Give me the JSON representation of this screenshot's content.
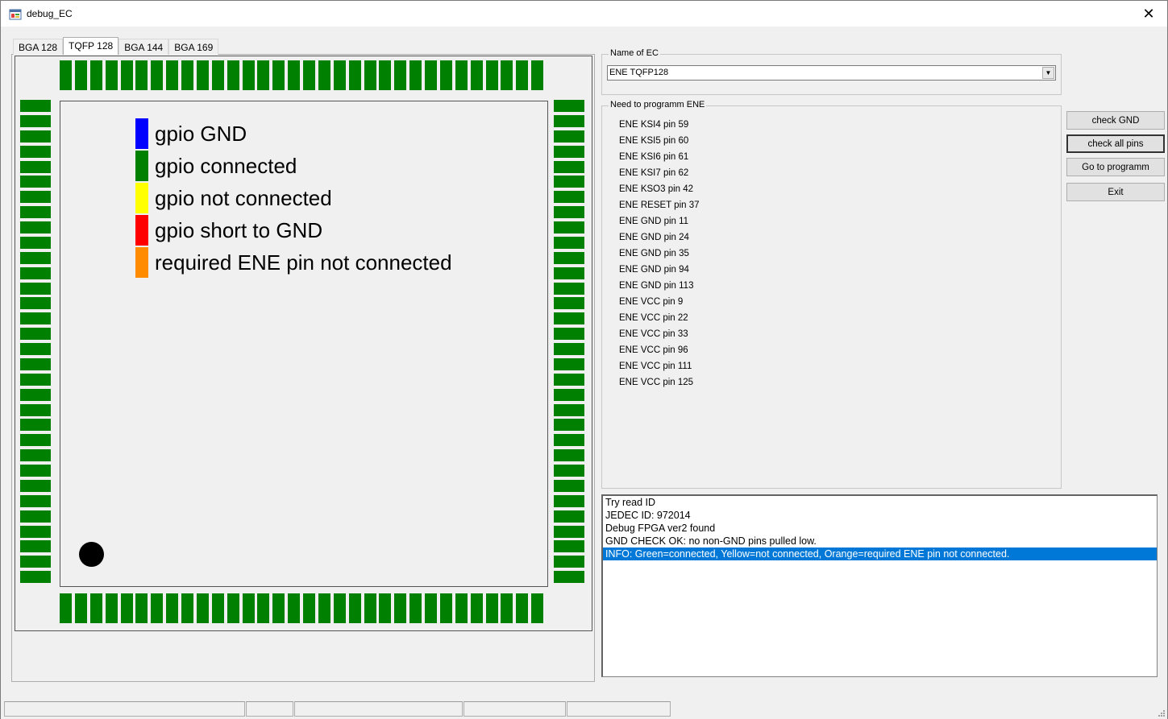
{
  "window": {
    "title": "debug_EC",
    "close_glyph": "✕"
  },
  "tabs": [
    {
      "label": "BGA 128",
      "active": false
    },
    {
      "label": "TQFP 128",
      "active": true
    },
    {
      "label": "BGA 144",
      "active": false
    },
    {
      "label": "BGA 169",
      "active": false
    }
  ],
  "legend": [
    {
      "label": "gpio GND",
      "color": "#0000ff"
    },
    {
      "label": "gpio connected",
      "color": "#008000"
    },
    {
      "label": "gpio not connected",
      "color": "#ffff00"
    },
    {
      "label": "gpio short to GND",
      "color": "#ff0000"
    },
    {
      "label": "required ENE pin not connected",
      "color": "#ff8c00"
    }
  ],
  "pin_color": "#008000",
  "ec_name": {
    "group_label": "Name of EC",
    "selected": "ENE TQFP128"
  },
  "ene_program": {
    "group_label": "Need to programm ENE",
    "items": [
      "ENE KSI4  pin 59",
      "ENE KSI5  pin 60",
      "ENE KSI6  pin 61",
      "ENE KSI7  pin 62",
      "ENE KSO3  pin 42",
      "ENE RESET pin 37",
      "ENE GND pin 11",
      "ENE GND pin 24",
      "ENE GND pin 35",
      "ENE GND pin 94",
      "ENE GND pin 113",
      "ENE VCC pin 9",
      "ENE VCC pin 22",
      "ENE VCC pin 33",
      "ENE VCC pin 96",
      "ENE VCC pin 111",
      "ENE VCC pin 125"
    ]
  },
  "buttons": {
    "check_gnd": "check GND",
    "check_all_pins": "check all pins",
    "go_to_programm": "Go to programm",
    "exit": "Exit"
  },
  "log": {
    "lines": [
      "Try read ID",
      "JEDEC ID: 972014",
      "Debug FPGA ver2 found",
      "GND CHECK OK: no non-GND pins pulled low.",
      "INFO: Green=connected, Yellow=not connected, Orange=required ENE pin not connected."
    ],
    "selected_index": 4
  }
}
